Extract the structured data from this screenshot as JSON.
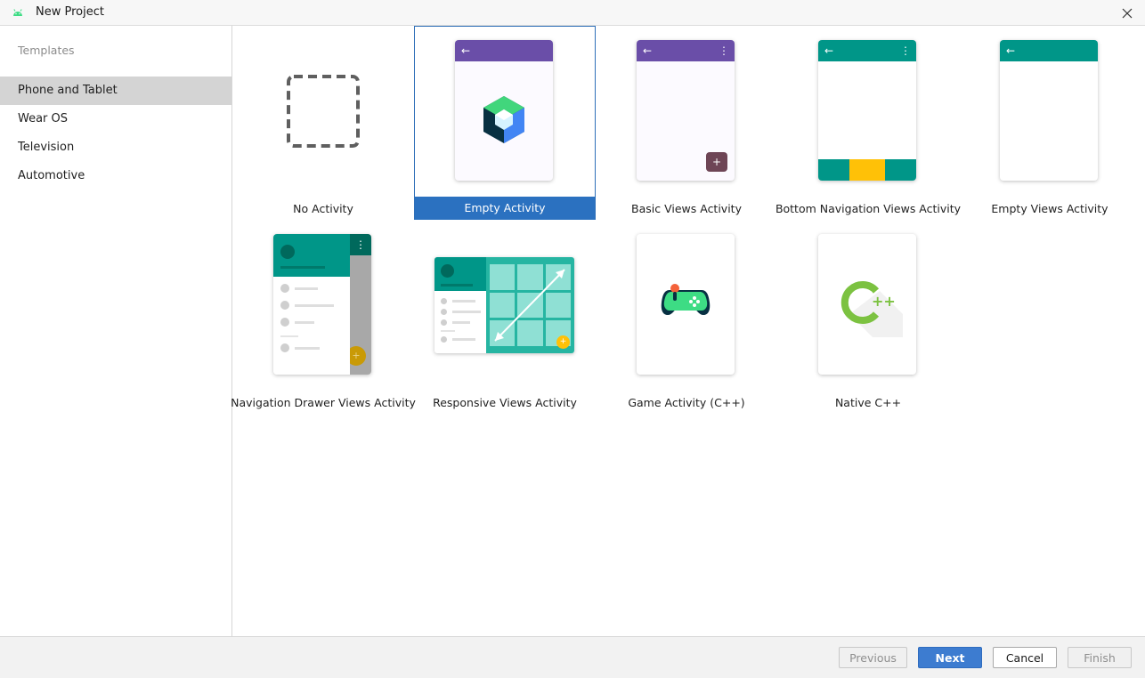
{
  "window": {
    "title": "New Project"
  },
  "sidebar": {
    "header": "Templates",
    "items": [
      {
        "label": "Phone and Tablet",
        "selected": true
      },
      {
        "label": "Wear OS",
        "selected": false
      },
      {
        "label": "Television",
        "selected": false
      },
      {
        "label": "Automotive",
        "selected": false
      }
    ]
  },
  "templates": [
    {
      "label": "No Activity",
      "selected": false
    },
    {
      "label": "Empty Activity",
      "selected": true
    },
    {
      "label": "Basic Views Activity",
      "selected": false
    },
    {
      "label": "Bottom Navigation Views Activity",
      "selected": false
    },
    {
      "label": "Empty Views Activity",
      "selected": false
    },
    {
      "label": "Navigation Drawer Views Activity",
      "selected": false
    },
    {
      "label": "Responsive Views Activity",
      "selected": false
    },
    {
      "label": "Game Activity (C++)",
      "selected": false
    },
    {
      "label": "Native C++",
      "selected": false
    }
  ],
  "buttons": {
    "previous": "Previous",
    "next": "Next",
    "cancel": "Cancel",
    "finish": "Finish"
  },
  "colors": {
    "selection": "#2b71c0",
    "sidebar_selected": "#d4d4d4",
    "appbar_purple": "#6a4ea8",
    "appbar_teal": "#009688",
    "accent_yellow": "#ffc107",
    "android_green": "#3ddc84"
  },
  "icons": {
    "app": "android-icon",
    "close": "close-icon",
    "back": "back-arrow-icon",
    "overflow": "overflow-menu-icon",
    "fab": "plus-icon",
    "compose": "jetpack-compose-icon",
    "game": "gamepad-icon",
    "cpp": "cpp-logo-icon"
  }
}
